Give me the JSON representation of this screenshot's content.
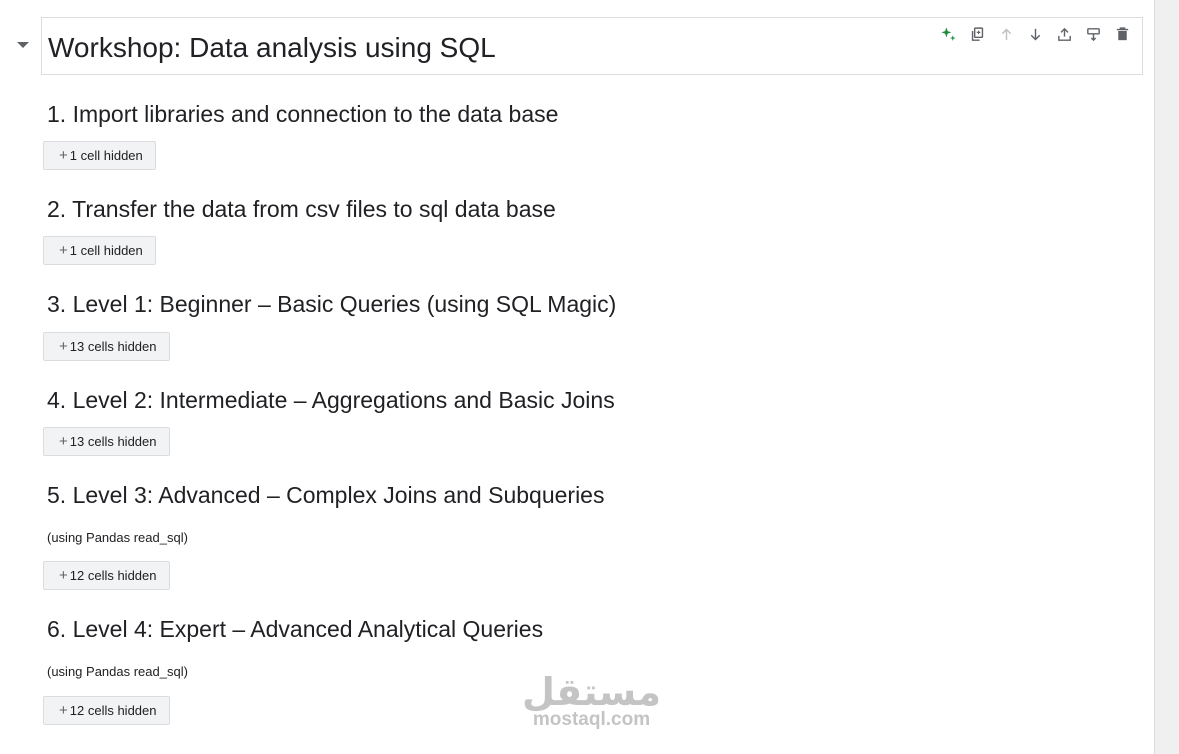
{
  "title": "Workshop: Data analysis using SQL",
  "toolbar": {
    "icons": [
      "sparkle-icon",
      "copy-link-icon",
      "arrow-up-icon",
      "arrow-down-icon",
      "upload-icon",
      "edit-comment-icon",
      "delete-icon"
    ],
    "colors": {
      "sparkle": "#1e8e3e",
      "default": "#5f6368",
      "disabled": "#bdc1c6"
    }
  },
  "sections": [
    {
      "heading": "1. Import libraries and connection to the data base",
      "note": "",
      "hidden_label": "1 cell hidden"
    },
    {
      "heading": "2. Transfer the data from csv files to sql data base",
      "note": "",
      "hidden_label": "1 cell hidden"
    },
    {
      "heading": "3. Level 1: Beginner – Basic Queries (using SQL Magic)",
      "note": "",
      "hidden_label": "13 cells hidden"
    },
    {
      "heading": "4. Level 2: Intermediate – Aggregations and Basic Joins",
      "note": "",
      "hidden_label": "13 cells hidden"
    },
    {
      "heading": "5. Level 3: Advanced – Complex Joins and Subqueries",
      "note": "(using Pandas read_sql)",
      "hidden_label": "12 cells hidden"
    },
    {
      "heading": "6. Level 4: Expert – Advanced Analytical Queries",
      "note": "(using Pandas read_sql)",
      "hidden_label": "12 cells hidden"
    }
  ],
  "watermark": {
    "arabic": "مستقل",
    "latin": "mostaql.com"
  }
}
